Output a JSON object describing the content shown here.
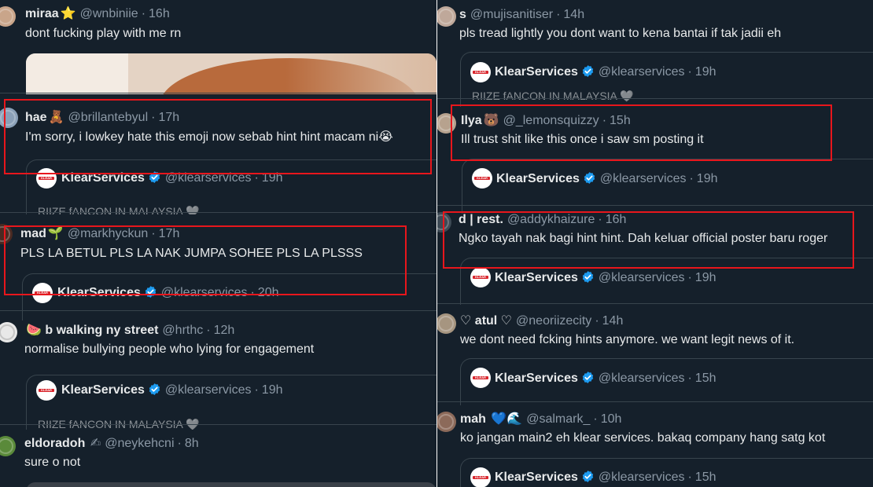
{
  "left": {
    "tweets": [
      {
        "name": "miraa",
        "emoji": "⭐",
        "handle": "@wnbiniie",
        "time": "16h",
        "text": "dont fucking play with me rn"
      },
      {
        "name": "hae",
        "emoji": "🧸",
        "handle": "@brillantebyul",
        "time": "17h",
        "text": "I'm sorry, i lowkey hate this emoji now sebab hint hint macam ni😭",
        "quote": {
          "name": "KlearServices",
          "handle": "@klearservices",
          "time": "19h",
          "preview": "RIIZE fANCON IN MALAYSIA 🤍"
        }
      },
      {
        "name": "mad",
        "emoji": "🌱",
        "handle": "@markhyckun",
        "time": "17h",
        "text": "PLS LA BETUL PLS LA NAK JUMPA SOHEE PLS LA PLSSS",
        "quote": {
          "name": "KlearServices",
          "handle": "@klearservices",
          "time": "20h"
        }
      },
      {
        "name": "b walking ny street",
        "emoji": "🍉",
        "handle": "@hrthc",
        "time": "12h",
        "text": "normalise bullying people who lying for engagement",
        "quote": {
          "name": "KlearServices",
          "handle": "@klearservices",
          "time": "19h",
          "preview": "RIIZE fANCON IN MALAYSIA 🤍"
        }
      },
      {
        "name": "eldoradoh",
        "emoji": "✍",
        "handle": "@neykehcni",
        "time": "8h",
        "text": "sure o not"
      }
    ]
  },
  "right": {
    "tweets": [
      {
        "name": "s",
        "emoji": "",
        "handle": "@mujisanitiser",
        "time": "14h",
        "text": "pls tread lightly you dont want to kena bantai if tak jadii eh",
        "quote": {
          "name": "KlearServices",
          "handle": "@klearservices",
          "time": "19h",
          "preview": "RIIZE fANCON IN MALAYSIA 🤍"
        }
      },
      {
        "name": "Ilya",
        "emoji": "🐻",
        "handle": "@_lemonsquizzy",
        "time": "15h",
        "text": "Ill trust shit like this once i saw sm posting it",
        "quote": {
          "name": "KlearServices",
          "handle": "@klearservices",
          "time": "19h"
        }
      },
      {
        "name": "d | rest.",
        "emoji": "",
        "handle": "@addykhaizure",
        "time": "16h",
        "text": "Ngko tayah nak bagi hint hint. Dah keluar official poster baru roger",
        "quote": {
          "name": "KlearServices",
          "handle": "@klearservices",
          "time": "19h"
        }
      },
      {
        "name": "♡ atul ♡",
        "emoji": "",
        "handle": "@neoriizecity",
        "time": "14h",
        "text": "we dont need fcking hints anymore. we want legit news of it.",
        "quote": {
          "name": "KlearServices",
          "handle": "@klearservices",
          "time": "15h"
        }
      },
      {
        "name": "mah",
        "emoji": "💙🌊",
        "handle": "@salmark_",
        "time": "10h",
        "text": "ko jangan main2 eh klear services. bakaq company hang satg kot",
        "quote": {
          "name": "KlearServices",
          "handle": "@klearservices",
          "time": "15h"
        }
      }
    ]
  },
  "colors": {
    "background": "#15202b",
    "text": "#e7e9ea",
    "muted": "#8b98a5",
    "highlight": "#e8161c",
    "verified": "#1d9bf0"
  }
}
